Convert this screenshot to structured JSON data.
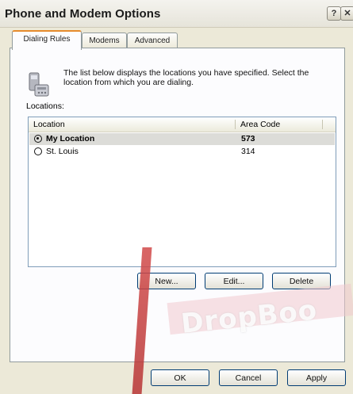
{
  "window": {
    "title": "Phone and Modem Options",
    "help_glyph": "?",
    "close_glyph": "✕"
  },
  "tabs": [
    {
      "label": "Dialing Rules",
      "active": true
    },
    {
      "label": "Modems",
      "active": false
    },
    {
      "label": "Advanced",
      "active": false
    }
  ],
  "dialing_rules": {
    "description": "The list below displays the locations you have specified. Select the location from which you are dialing.",
    "locations_label": "Locations:",
    "columns": [
      "Location",
      "Area Code"
    ],
    "rows": [
      {
        "location": "My Location",
        "area_code": "573",
        "selected": true,
        "bold": true
      },
      {
        "location": "St. Louis",
        "area_code": "314",
        "selected": false,
        "bold": false
      }
    ]
  },
  "panel_buttons": {
    "new_label": "New...",
    "edit_label": "Edit...",
    "delete_label": "Delete"
  },
  "dialog_buttons": {
    "ok_label": "OK",
    "cancel_label": "Cancel",
    "apply_label": "Apply"
  },
  "watermark": "DropBoo",
  "colors": {
    "dialog_bg": "#ece9d8",
    "active_tab_accent": "#e68b2c",
    "button_border": "#003c74"
  }
}
